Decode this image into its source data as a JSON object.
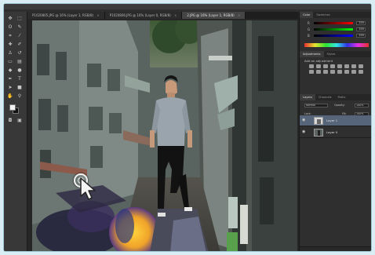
{
  "app": {
    "name": "Adobe Photoshop",
    "icon": "photoshop-icon"
  },
  "document_tabs": [
    {
      "label": "P1020805.JPG @ 16% (Layer 1, RGB/8)",
      "active": false
    },
    {
      "label": "P1020806.JPG @ 16% (Layer 0, RGB/8)",
      "active": false
    },
    {
      "label": "2.JPG @ 16% (Layer 1, RGB/8)",
      "active": true
    }
  ],
  "tools": [
    "move-tool-icon",
    "marquee-tool-icon",
    "lasso-tool-icon",
    "quick-select-tool-icon",
    "crop-tool-icon",
    "eyedropper-tool-icon",
    "healing-brush-tool-icon",
    "brush-tool-icon",
    "clone-stamp-tool-icon",
    "history-brush-tool-icon",
    "eraser-tool-icon",
    "gradient-tool-icon",
    "blur-tool-icon",
    "dodge-tool-icon",
    "pen-tool-icon",
    "type-tool-icon",
    "path-select-tool-icon",
    "shape-tool-icon",
    "hand-tool-icon",
    "zoom-tool-icon"
  ],
  "color_panel": {
    "tabs": [
      "Color",
      "Swatches"
    ],
    "active_tab": "Color",
    "sliders": [
      {
        "label": "R",
        "value": "255",
        "gradient": [
          "#000000",
          "#ff0000"
        ]
      },
      {
        "label": "G",
        "value": "255",
        "gradient": [
          "#000000",
          "#00ff00"
        ]
      },
      {
        "label": "B",
        "value": "255",
        "gradient": [
          "#000000",
          "#0000ff"
        ]
      }
    ]
  },
  "adjustments_panel": {
    "tabs": [
      "Adjustments",
      "Styles"
    ],
    "active_tab": "Adjustments",
    "heading": "Add an adjustment",
    "icon_count": 16
  },
  "layers_panel": {
    "tabs": [
      "Layers",
      "Channels",
      "Paths"
    ],
    "active_tab": "Layers",
    "blend_mode": "Normal",
    "opacity_label": "Opacity:",
    "opacity": "100%",
    "lock_label": "Lock:",
    "fill_label": "Fill:",
    "fill": "100%",
    "layers": [
      {
        "name": "Layer 1",
        "selected": true
      },
      {
        "name": "Layer 0",
        "selected": false
      }
    ]
  },
  "colors": {
    "foreground": "#f2f2f2",
    "background": "#111111",
    "selected_layer": "#56657a"
  }
}
